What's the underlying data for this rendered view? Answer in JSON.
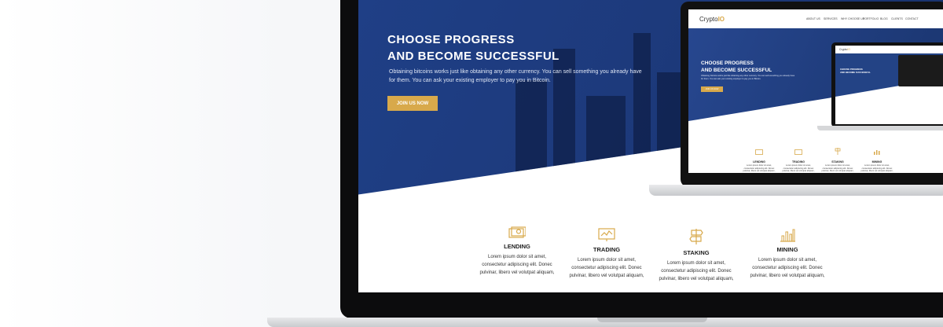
{
  "hero": {
    "title_line1": "CHOOSE PROGRESS",
    "title_line2": "AND BECOME SUCCESSFUL",
    "description": "Obtaining bitcoins works just like obtaining any other currency. You can sell something you already have for them. You can ask your existing employer to pay you in Bitcoin.",
    "cta": "JOIN US NOW"
  },
  "features": [
    {
      "title": "LENDING",
      "icon": "cash-icon",
      "line1": "Lorem ipsum dolor sit amet,",
      "line2": "consectetur adipiscing elit. Donec",
      "line3": "pulvinar, libero vel volutpat aliquam,"
    },
    {
      "title": "TRADING",
      "icon": "chart-board-icon",
      "line1": "Lorem ipsum dolor sit amet,",
      "line2": "consectetur adipiscing elit. Donec",
      "line3": "pulvinar, libero vel volutpat aliquam,"
    },
    {
      "title": "STAKING",
      "icon": "signpost-icon",
      "line1": "Lorem ipsum dolor sit amet,",
      "line2": "consectetur adipiscing elit. Donec",
      "line3": "pulvinar, libero vel volutpat aliquam,"
    },
    {
      "title": "MINING",
      "icon": "bar-chart-icon",
      "line1": "Lorem ipsum dolor sit amet,",
      "line2": "consectetur adipiscing elit. Donec",
      "line3": "pulvinar, libero vel volutpat aliquam,"
    }
  ],
  "mini_site": {
    "logo_text": "Crypto",
    "logo_suffix": "IO",
    "nav": [
      "ABOUT US",
      "SERVICES",
      "WHY CHOOSE US",
      "PORTFOLIO",
      "BLOG",
      "CLIENTS",
      "CONTACT"
    ],
    "title_line1": "CHOOSE PROGRESS",
    "title_line2": "AND BECOME SUCCESSFUL",
    "cta": "JOIN US NOW",
    "features": [
      "LENDING",
      "TRADING",
      "STAKING",
      "MINING"
    ]
  },
  "colors": {
    "accent": "#d8a94b",
    "hero_blue": "#1d3a7c"
  }
}
